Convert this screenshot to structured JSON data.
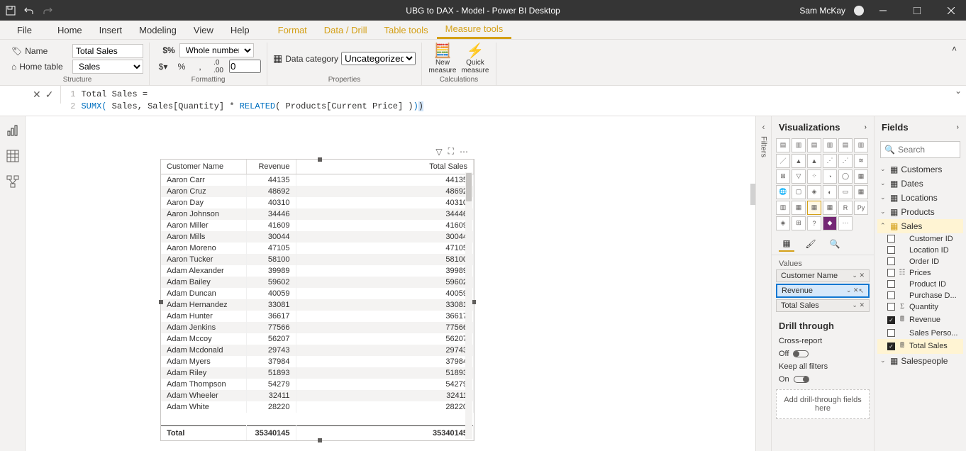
{
  "app": {
    "title": "UBG to DAX - Model - Power BI Desktop",
    "user": "Sam McKay"
  },
  "ribbonTabs": {
    "file": "File",
    "home": "Home",
    "insert": "Insert",
    "modeling": "Modeling",
    "view": "View",
    "help": "Help",
    "format": "Format",
    "dataDrill": "Data / Drill",
    "tableTools": "Table tools",
    "measureTools": "Measure tools"
  },
  "structure": {
    "nameLbl": "Name",
    "nameVal": "Total Sales",
    "homeTableLbl": "Home table",
    "homeTableVal": "Sales",
    "group": "Structure"
  },
  "formatting": {
    "formatVal": "Whole number",
    "decimalsVal": "0",
    "group": "Formatting"
  },
  "properties": {
    "dataCategoryLbl": "Data category",
    "dataCategoryVal": "Uncategorized",
    "group": "Properties"
  },
  "calculations": {
    "newMeasure": "New\nmeasure",
    "quickMeasure": "Quick\nmeasure",
    "group": "Calculations"
  },
  "formula": {
    "line1": "Total Sales =",
    "line2": {
      "fn1": "SUMX",
      "open": "(",
      "arg1": " Sales, Sales[Quantity] * ",
      "fn2": "RELATED",
      "arg2": "( Products[Current Price] )",
      "close": ")"
    }
  },
  "tableVisual": {
    "cols": [
      "Customer Name",
      "Revenue",
      "Total Sales"
    ],
    "rows": [
      [
        "Aaron Carr",
        44135,
        44135
      ],
      [
        "Aaron Cruz",
        48692,
        48692
      ],
      [
        "Aaron Day",
        40310,
        40310
      ],
      [
        "Aaron Johnson",
        34446,
        34446
      ],
      [
        "Aaron Miller",
        41609,
        41609
      ],
      [
        "Aaron Mills",
        30044,
        30044
      ],
      [
        "Aaron Moreno",
        47105,
        47105
      ],
      [
        "Aaron Tucker",
        58100,
        58100
      ],
      [
        "Adam Alexander",
        39989,
        39989
      ],
      [
        "Adam Bailey",
        59602,
        59602
      ],
      [
        "Adam Duncan",
        40059,
        40059
      ],
      [
        "Adam Hernandez",
        33081,
        33081
      ],
      [
        "Adam Hunter",
        36617,
        36617
      ],
      [
        "Adam Jenkins",
        77566,
        77566
      ],
      [
        "Adam Mccoy",
        56207,
        56207
      ],
      [
        "Adam Mcdonald",
        29743,
        29743
      ],
      [
        "Adam Myers",
        37984,
        37984
      ],
      [
        "Adam Riley",
        51893,
        51893
      ],
      [
        "Adam Thompson",
        54279,
        54279
      ],
      [
        "Adam Wheeler",
        32411,
        32411
      ],
      [
        "Adam White",
        28220,
        28220
      ]
    ],
    "totalLbl": "Total",
    "totals": [
      35340145,
      35340145
    ]
  },
  "filtersPane": "Filters",
  "vizPane": {
    "title": "Visualizations",
    "valuesLbl": "Values",
    "wells": [
      "Customer Name",
      "Revenue",
      "Total Sales"
    ],
    "drillTitle": "Drill through",
    "crossReport": "Cross-report",
    "off": "Off",
    "keepFilters": "Keep all filters",
    "on": "On",
    "dz": "Add drill-through fields here"
  },
  "fieldsPane": {
    "title": "Fields",
    "searchPh": "Search",
    "tables": {
      "customers": "Customers",
      "dates": "Dates",
      "locations": "Locations",
      "products": "Products",
      "sales": "Sales",
      "salespeople": "Salespeople"
    },
    "salesCols": {
      "customerId": "Customer ID",
      "locationId": "Location ID",
      "orderId": "Order ID",
      "prices": "Prices",
      "productId": "Product ID",
      "purchaseD": "Purchase D...",
      "quantity": "Quantity",
      "revenue": "Revenue",
      "salesPerso": "Sales Perso...",
      "totalSales": "Total Sales"
    }
  }
}
